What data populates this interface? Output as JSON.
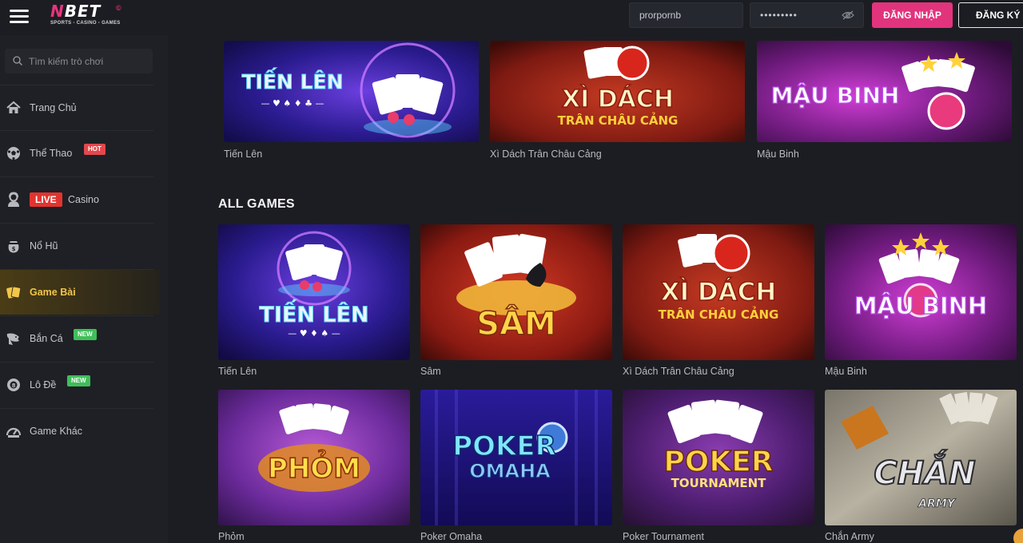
{
  "header": {
    "logo_text": "NBET",
    "logo_reg": "©",
    "logo_tagline": "SPORTS - CASINO - GAMES",
    "username_value": "prorpornb",
    "password_value": "•••••••••",
    "login_label": "ĐĂNG NHẬP",
    "register_label": "ĐĂNG KÝ"
  },
  "sidebar": {
    "search_placeholder": "Tìm kiếm trò chơi",
    "items": [
      {
        "label": "Trang Chủ",
        "icon": "home-icon"
      },
      {
        "label": "Thể Thao",
        "icon": "soccer-ball-icon",
        "badge": "HOT"
      },
      {
        "label": "Casino",
        "icon": "dealer-icon",
        "prefix_badge": "LIVE"
      },
      {
        "label": "Nổ Hũ",
        "icon": "jackpot-pot-icon"
      },
      {
        "label": "Game Bài",
        "icon": "cards-icon",
        "active": true
      },
      {
        "label": "Bắn Cá",
        "icon": "fish-icon",
        "badge": "NEW"
      },
      {
        "label": "Lô Đề",
        "icon": "lottery-ball-icon",
        "badge": "NEW"
      },
      {
        "label": "Game Khác",
        "icon": "gauge-icon"
      }
    ]
  },
  "featured": [
    {
      "title": "Tiến Lên",
      "art": "TIẾN LÊN",
      "art2": ""
    },
    {
      "title": "Xì Dách Trân Châu Cảng",
      "art": "XÌ DÁCH",
      "art2": "TRÂN CHÂU CẢNG"
    },
    {
      "title": "Mậu Binh",
      "art": "MẬU BINH",
      "art2": ""
    }
  ],
  "all_games_title": "ALL GAMES",
  "games": [
    {
      "title": "Tiến Lên",
      "art": "TIẾN LÊN",
      "art2": ""
    },
    {
      "title": "Sâm",
      "art": "SÂM",
      "art2": ""
    },
    {
      "title": "Xì Dách Trân Châu Cảng",
      "art": "XÌ DÁCH",
      "art2": "TRÂN CHÂU CẢNG"
    },
    {
      "title": "Mậu Binh",
      "art": "MẬU BINH",
      "art2": ""
    },
    {
      "title": "Phỏm",
      "art": "PHỎM",
      "art2": ""
    },
    {
      "title": "Poker Omaha",
      "art": "POKER",
      "art2": "OMAHA"
    },
    {
      "title": "Poker Tournament",
      "art": "POKER",
      "art2": "TOURNAMENT"
    },
    {
      "title": "Chắn Army",
      "art": "CHẮN",
      "art2": "ARMY"
    }
  ],
  "colors": {
    "brand_pink": "#e2337d",
    "active_gold": "#f1c64a",
    "hot_red": "#e2484c",
    "new_green": "#3fbf5a"
  }
}
